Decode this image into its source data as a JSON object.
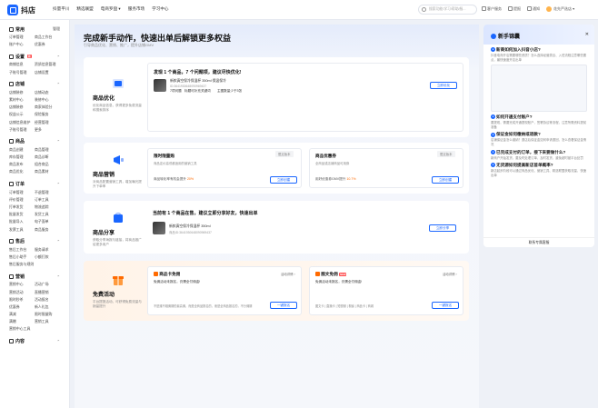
{
  "brand": {
    "name": "抖店"
  },
  "topnav": [
    "抖量平川",
    "精选联盟",
    "电商罗盘 ▾",
    "服务市场",
    "学习中心"
  ],
  "search": {
    "placeholder": "搜索功能/学习/帮助/服..."
  },
  "top_right": {
    "service": "客户服务",
    "ticket": "提报",
    "notice": "通知",
    "shop": "花先严选店 ▾"
  },
  "sidebar": [
    {
      "title": "常用",
      "action": "管理",
      "items": [
        "订单管理",
        "商品工作台",
        "账户中心",
        "优惠券"
      ]
    },
    {
      "title": "设置",
      "items": [
        "商铺信息",
        "资质信息管理",
        "子账号管理",
        "店铺设置"
      ],
      "new_badge": "新"
    },
    {
      "title": "店铺",
      "items": [
        "店铺装修",
        "店铺动态",
        "素材中心",
        "装修中心",
        "店铺装修",
        "商家体验分",
        "权益公示",
        "保险服务",
        "店铺信息维护",
        "经营管理",
        "子账号管理",
        "更多"
      ]
    },
    {
      "title": "商品",
      "items": [
        "商品创建",
        "商品管理",
        "库存管理",
        "商品诊断",
        "商品发布",
        "组合商品",
        "商品优化",
        "商品素材"
      ]
    },
    {
      "title": "订单",
      "items": [
        "订单管理",
        "不退管理",
        "评价管理",
        "订单工具",
        "打单发货",
        "物流追踪",
        "批量发货",
        "发货工具",
        "批量导入",
        "电子面单",
        "发票工具",
        "商品服务"
      ]
    },
    {
      "title": "售后",
      "items": [
        "售后工作台",
        "服务请求",
        "售后小助手",
        "小额打款",
        "售后服务与规则"
      ]
    },
    {
      "title": "营销",
      "items": [
        "营销中心",
        "活动广场",
        "营销活动",
        "直播营销",
        "限时秒杀",
        "活动报名",
        "优惠券",
        "新人礼包",
        "满减",
        "限时限量购",
        "满赠",
        "营销工具",
        "营销中心工具"
      ]
    },
    {
      "title": "内容"
    }
  ],
  "hero": {
    "title": "完成新手动作，快速出单后解锁更多权益",
    "subtitle": "引导商品优化、营销、推广，提升店铺GMV"
  },
  "cards": [
    {
      "title": "商品优化",
      "desc": "优化商品信息，获得更多免费流量和搜索排序",
      "headline": "发现 1 个商品，7 个问题项，建议尽快优化!",
      "product_name": "新款真空保冷保温杯 350ml 保温保冷",
      "product_id": "ID:3641930648090969437",
      "issue1": "7项问题",
      "issue2": "标题可补充关键词",
      "issue3": "主图数量少于3张",
      "button": "立即优化"
    },
    {
      "title": "商品营销",
      "desc": "对商品配置营销工具，增加曝光提升下单率",
      "sub1": {
        "title": "限时限量购",
        "desc": "商品定价高低都适用的营销工具",
        "stat": "商品转化率有机会提升",
        "value": "20%",
        "tag": "限定版本",
        "button": "立即创建"
      },
      "sub2": {
        "title": "商品优惠券",
        "desc": "全商品或店铺商品可用券",
        "stat": "用好优惠券GMV提升",
        "value": "10.7%",
        "tag": "限定版本",
        "button": "立即创建"
      }
    },
    {
      "title": "商品分享",
      "desc": "获取分享海报与链接，将商品推广给更多用户",
      "headline": "当前有 1 个商品在售，建议立即分享好友，快速出单",
      "product_name": "新款真空保冷保温杯 350ml",
      "product_id": "商品ID:3641930648090969437",
      "button": "立即分享"
    },
    {
      "title": "免费活动",
      "desc": "平台提报活动，可获得免费流量与销量提升",
      "sub1": {
        "title": "商品卡免佣",
        "desc": "免佣活动未报名，仍需全付佣金!",
        "note": "不是赚不赚佣期的最高佣，而是全商品报名的，而是全商品报名的，不分佣期",
        "link": "活动详情 ›",
        "button": "一键报名"
      },
      "sub2": {
        "title": "图文免佣",
        "badge": "NEW",
        "desc": "免佣活动未报名，仍需全付佣金!",
        "note": "图文卡 | 直播卡 | 短视频 | 橱窗 | 商品卡 | 商城",
        "link": "活动详情 ›",
        "button": "一键报名"
      }
    }
  ],
  "panel": {
    "title": "新手锦囊",
    "tips": [
      {
        "title": "新商如何加入抖音小店?",
        "desc": "抖音电商开店需要哪些资质？怎么选择经营类目、入驻流程注意哪些要点，最快速度开店出单"
      },
      {
        "title": "如何开通支付账户?",
        "desc": "要提现，需要完成开通提现账户，签署协议等流程，注意所需资料提前准备"
      },
      {
        "title": "保证金如何缴纳或退款?",
        "desc": "店铺保证金怎么缴纳？退店后保证金如何申请退回，怎么查看保证金情况"
      },
      {
        "title": "已完成支付的订单，接下来要做什么?",
        "desc": "新商户开始发货，要及时处理订单，及时发货，避免超时被平台处罚"
      },
      {
        "title": "无货源如何提高新店首单概率?",
        "desc": "新店起步阶段可以通过商品优化、营销工具、精选联盟获取流量，快速出单"
      }
    ],
    "footer": "联系专属客服"
  },
  "colors": {
    "accent": "#1966ff",
    "orange": "#ff6a00"
  }
}
